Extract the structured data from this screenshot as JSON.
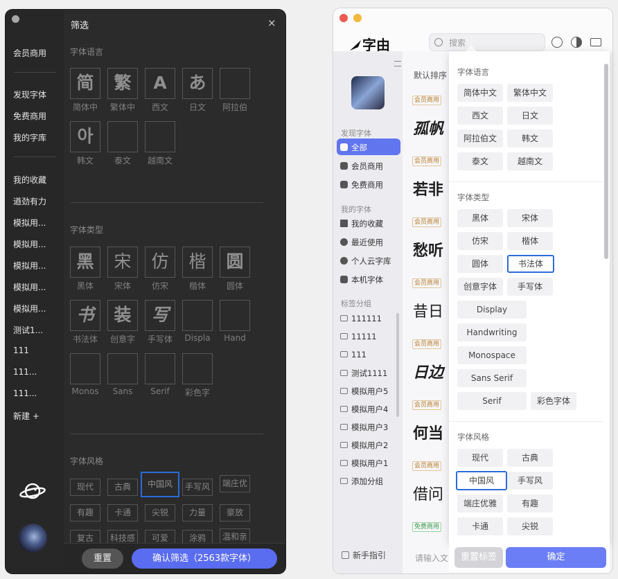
{
  "dark": {
    "sidebar": [
      "会员商用",
      "发现字体",
      "免费商用",
      "我的字库",
      "我的收藏",
      "遒劲有力",
      "模拟用...",
      "模拟用...",
      "模拟用...",
      "模拟用...",
      "模拟用...",
      "测试1...",
      "111",
      "111...",
      "111...",
      "新建 +"
    ],
    "title": "筛选",
    "close": "×",
    "sections": {
      "lang": "字体语言",
      "type": "字体类型",
      "style": "字体风格"
    },
    "lang_glyphs": [
      {
        "glyph": "简",
        "label": "简体中"
      },
      {
        "glyph": "繁",
        "label": "繁体中"
      },
      {
        "glyph": "A",
        "label": "西文"
      },
      {
        "glyph": "あ",
        "label": "日文"
      },
      {
        "glyph": "",
        "label": "阿拉伯"
      },
      {
        "glyph": "아",
        "label": "韩文"
      },
      {
        "glyph": "",
        "label": "泰文"
      },
      {
        "glyph": "",
        "label": "越南文"
      }
    ],
    "type_glyphs": [
      {
        "glyph": "黑",
        "label": "黑体"
      },
      {
        "glyph": "宋",
        "label": "宋体"
      },
      {
        "glyph": "仿",
        "label": "仿宋"
      },
      {
        "glyph": "楷",
        "label": "楷体"
      },
      {
        "glyph": "圆",
        "label": "圆体"
      },
      {
        "glyph": "书",
        "label": "书法体"
      },
      {
        "glyph": "装",
        "label": "创意字"
      },
      {
        "glyph": "写",
        "label": "手写体"
      },
      {
        "glyph": "",
        "label": "Displa"
      },
      {
        "glyph": "",
        "label": "Hand"
      },
      {
        "glyph": "",
        "label": "Monos"
      },
      {
        "glyph": "",
        "label": "Sans"
      },
      {
        "glyph": "",
        "label": "Serif"
      },
      {
        "glyph": "",
        "label": "彩色字"
      }
    ],
    "style_tags": [
      "现代",
      "古典",
      "中国风",
      "手写风",
      "端庄优",
      "有趣",
      "卡通",
      "尖锐",
      "力量",
      "豪放",
      "复古",
      "科技感",
      "可爱",
      "涂鸦",
      "温和亲"
    ],
    "reset": "重置",
    "confirm": "确认筛选（2563款字体）"
  },
  "light": {
    "logo": "字由",
    "search_placeholder": "搜索",
    "sidebar": {
      "discover_group": "发现字体",
      "all": "全部",
      "vip": "会员商用",
      "free": "免费商用",
      "mine_group": "我的字体",
      "fav": "我的收藏",
      "recent": "最近使用",
      "cloud": "个人云字库",
      "local": "本机字体",
      "tag_group": "标签分组",
      "tags": [
        "111111",
        "11111",
        "111",
        "测试1111",
        "模拟用户5",
        "模拟用户4",
        "模拟用户3",
        "模拟用户2",
        "模拟用户1",
        "添加分组"
      ],
      "guide": "新手指引"
    },
    "sort": "默认排序",
    "samples": [
      {
        "badge": "会员商用",
        "text": "孤帆"
      },
      {
        "badge": "会员商用",
        "text": "若非"
      },
      {
        "badge": "会员商用",
        "text": "愁听"
      },
      {
        "badge": "会员商用",
        "text": "昔日"
      },
      {
        "badge": "会员商用",
        "text": "日边"
      },
      {
        "badge": "会员商用",
        "text": "何当"
      },
      {
        "badge": "会员商用",
        "text": "借问"
      },
      {
        "badge": "免费商用",
        "text": ""
      }
    ],
    "input_placeholder": "请输入文",
    "panel": {
      "lang_title": "字体语言",
      "lang": [
        "简体中文",
        "繁体中文",
        "西文",
        "日文",
        "阿拉伯文",
        "韩文",
        "泰文",
        "越南文"
      ],
      "type_title": "字体类型",
      "type": [
        "黑体",
        "宋体",
        "仿宋",
        "楷体",
        "圆体",
        "书法体",
        "创意字体",
        "手写体",
        "Display",
        "Handwriting",
        "Monospace",
        "Sans Serif",
        "Serif",
        "彩色字体"
      ],
      "style_title": "字体风格",
      "style": [
        "现代",
        "古典",
        "中国风",
        "手写风",
        "端庄优雅",
        "有趣",
        "卡通",
        "尖锐"
      ],
      "reset": "重置标签",
      "ok": "确定"
    }
  },
  "colors": {
    "accent": "#6175ef",
    "selected_border": "#2b6bdc"
  }
}
